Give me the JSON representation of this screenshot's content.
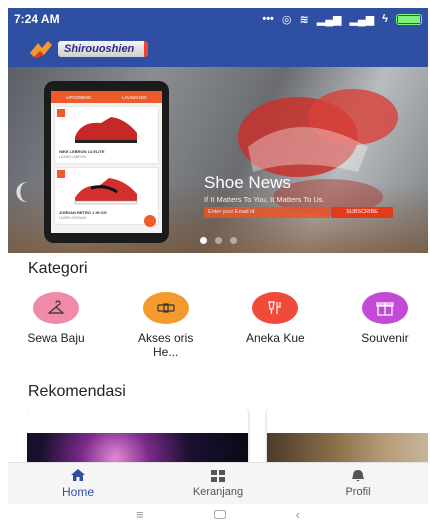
{
  "status_bar": {
    "time": "7:24 AM",
    "icons": [
      "dots-icon",
      "alarm-icon",
      "wifi-icon",
      "signal-icon",
      "signal-icon",
      "charging-icon",
      "battery-icon"
    ]
  },
  "app_bar": {
    "logo_text": "Shirouoshien"
  },
  "banner": {
    "title": "Shoe News",
    "subtitle": "If It Matters To You, It Matters To Us.",
    "email_placeholder": "Enter your Email id",
    "subscribe_label": "SUBSCRIBE",
    "phone": {
      "tab_1": "UPCOMING",
      "tab_2": "LAUNCHED",
      "product_1_title": "NIKE LEBRON 14 ELITE",
      "product_1_sub": "LEARN LEBRON",
      "product_2_title": "JORDAN RETRO 1 HI OG",
      "product_2_sub": "LEARN JORDAN"
    },
    "slides_total": 3,
    "active_slide": 1
  },
  "categories": {
    "title": "Kategori",
    "items": [
      {
        "label": "Sewa Baju",
        "icon": "hanger-icon",
        "color": "#f08aa8"
      },
      {
        "label": "Akses oris He...",
        "icon": "belt-icon",
        "color": "#f39a2e"
      },
      {
        "label": "Aneka Kue",
        "icon": "cake-icon",
        "color": "#ef4a3a"
      },
      {
        "label": "Souvenir",
        "icon": "gift-icon",
        "color": "#c24ad6"
      }
    ]
  },
  "recommendations": {
    "title": "Rekomendasi"
  },
  "bottom_nav": {
    "items": [
      {
        "label": "Home",
        "icon": "home-icon",
        "active": true
      },
      {
        "label": "Keranjang",
        "icon": "cart-grid-icon",
        "active": false
      },
      {
        "label": "Profil",
        "icon": "bell-icon",
        "active": false
      }
    ]
  },
  "system_nav": {
    "icons": [
      "menu-icon",
      "home-square-icon",
      "back-icon"
    ]
  },
  "colors": {
    "primary": "#2f4fa3",
    "accent": "#ee5a2a"
  }
}
